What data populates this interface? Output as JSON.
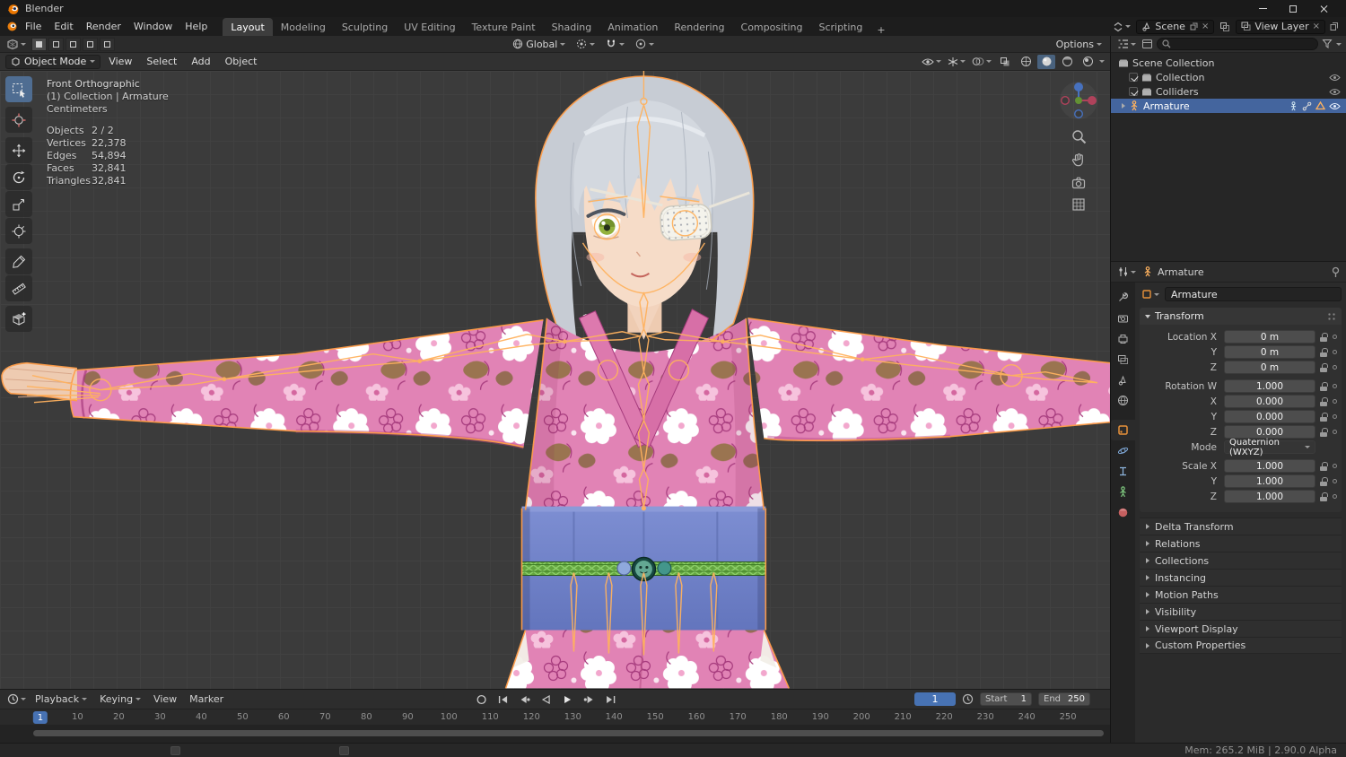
{
  "titlebar": {
    "app": "Blender"
  },
  "menubar": {
    "menus": [
      "File",
      "Edit",
      "Render",
      "Window",
      "Help"
    ],
    "workspaces": [
      "Layout",
      "Modeling",
      "Sculpting",
      "UV Editing",
      "Texture Paint",
      "Shading",
      "Animation",
      "Rendering",
      "Compositing",
      "Scripting"
    ],
    "new_workspace": "+",
    "scene": "Scene",
    "view_layer": "View Layer"
  },
  "toolsettings": {
    "orientation": "Global",
    "options": "Options"
  },
  "viewport_header": {
    "mode": "Object Mode",
    "menus": [
      "View",
      "Select",
      "Add",
      "Object"
    ]
  },
  "viewport": {
    "view_name": "Front Orthographic",
    "context": "(1) Collection | Armature",
    "units": "Centimeters",
    "stats": [
      {
        "label": "Objects",
        "value": "2 / 2"
      },
      {
        "label": "Vertices",
        "value": "22,378"
      },
      {
        "label": "Edges",
        "value": "54,894"
      },
      {
        "label": "Faces",
        "value": "32,841"
      },
      {
        "label": "Triangles",
        "value": "32,841"
      }
    ]
  },
  "outliner": {
    "items": [
      {
        "label": "Scene Collection"
      },
      {
        "label": "Collection"
      },
      {
        "label": "Colliders"
      },
      {
        "label": "Armature"
      }
    ]
  },
  "properties": {
    "breadcrumb": "Armature",
    "name": "Armature",
    "transform_title": "Transform",
    "rows": [
      {
        "label": "Location X",
        "value": "0 m"
      },
      {
        "label": "Y",
        "value": "0 m"
      },
      {
        "label": "Z",
        "value": "0 m"
      },
      {
        "label": "Rotation W",
        "value": "1.000"
      },
      {
        "label": "X",
        "value": "0.000"
      },
      {
        "label": "Y",
        "value": "0.000"
      },
      {
        "label": "Z",
        "value": "0.000"
      },
      {
        "label": "Scale X",
        "value": "1.000"
      },
      {
        "label": "Y",
        "value": "1.000"
      },
      {
        "label": "Z",
        "value": "1.000"
      }
    ],
    "mode_label": "Mode",
    "mode_value": "Quaternion (WXYZ)",
    "panels": [
      "Delta Transform",
      "Relations",
      "Collections",
      "Instancing",
      "Motion Paths",
      "Visibility",
      "Viewport Display",
      "Custom Properties"
    ]
  },
  "timeline": {
    "menus": [
      "Playback",
      "Keying",
      "View",
      "Marker"
    ],
    "current_frame": "1",
    "start_label": "Start",
    "start_value": "1",
    "end_label": "End",
    "end_value": "250",
    "ticks": [
      "1",
      "10",
      "20",
      "30",
      "40",
      "50",
      "60",
      "70",
      "80",
      "90",
      "100",
      "110",
      "120",
      "130",
      "140",
      "150",
      "160",
      "170",
      "180",
      "190",
      "200",
      "210",
      "220",
      "230",
      "240",
      "250"
    ]
  },
  "statusbar": {
    "info": "Mem: 265.2 MiB | 2.90.0 Alpha"
  },
  "icons": {
    "select-box": "dashed-square-cursor",
    "cursor-3d": "crosshair-circle",
    "move": "four-arrows",
    "rotate": "arc-arrow",
    "scale": "box-diagonal-arrow",
    "transform": "gizmo-circle",
    "annotate": "pen",
    "measure": "ruler",
    "add-cube": "cube-plus",
    "nav-gizmo": "axis-ball",
    "zoom": "magnifier",
    "pan": "hand",
    "camera-view": "camera",
    "ortho-toggle": "grid"
  },
  "colors": {
    "accent_blue": "#4772b3",
    "selection_outline": "#ff9d49",
    "armature_orange": "#e8912e",
    "viewport_bg": "#3b3b3b",
    "kimono_pink": "#e183b5",
    "obi_blue": "#7081c6",
    "hair_silver": "#c7ccd4"
  }
}
